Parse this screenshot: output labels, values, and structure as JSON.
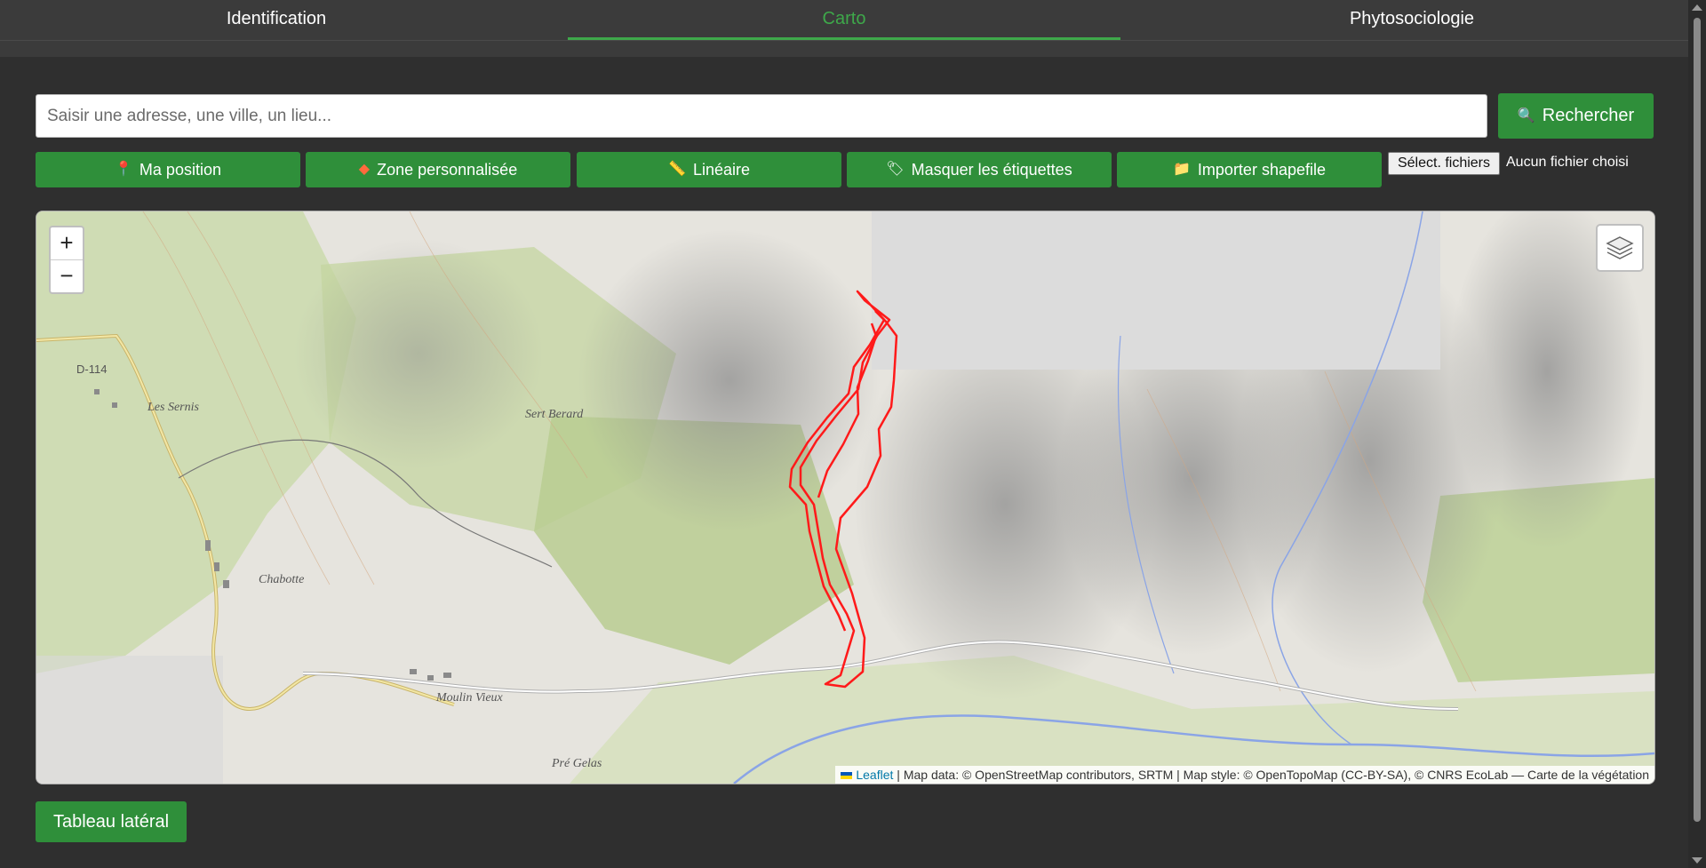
{
  "tabs": [
    {
      "label": "Identification",
      "active": false
    },
    {
      "label": "Carto",
      "active": true
    },
    {
      "label": "Phytosociologie",
      "active": false
    }
  ],
  "search": {
    "placeholder": "Saisir une adresse, une ville, un lieu...",
    "value": "",
    "button_label": "Rechercher",
    "button_icon": "search-icon"
  },
  "actions": [
    {
      "label": "Ma position",
      "icon": "pin-icon"
    },
    {
      "label": "Zone personnalisée",
      "icon": "diamond-icon"
    },
    {
      "label": "Linéaire",
      "icon": "ruler-icon"
    },
    {
      "label": "Masquer les étiquettes",
      "icon": "tag-icon"
    },
    {
      "label": "Importer shapefile",
      "icon": "folder-icon"
    }
  ],
  "file_input": {
    "button_label": "Sélect. fichiers",
    "status": "Aucun fichier choisi"
  },
  "map": {
    "zoom_in": "+",
    "zoom_out": "−",
    "attribution": {
      "link": "Leaflet",
      "text": "| Map data: © OpenStreetMap contributors, SRTM | Map style: © OpenTopoMap (CC-BY-SA), © CNRS EcoLab — Carte de la végétation"
    },
    "places": [
      "Les Sernis",
      "Sert Berard",
      "Chabotte",
      "Moulin Vieux",
      "Pré Gelas"
    ],
    "roads": [
      "D-114"
    ],
    "track_color": "#ff1a1a"
  },
  "side_panel_button": "Tableau latéral",
  "colors": {
    "accent": "#2f8f3a",
    "active_tab": "#3ea84a",
    "background": "#2f2f2f"
  }
}
